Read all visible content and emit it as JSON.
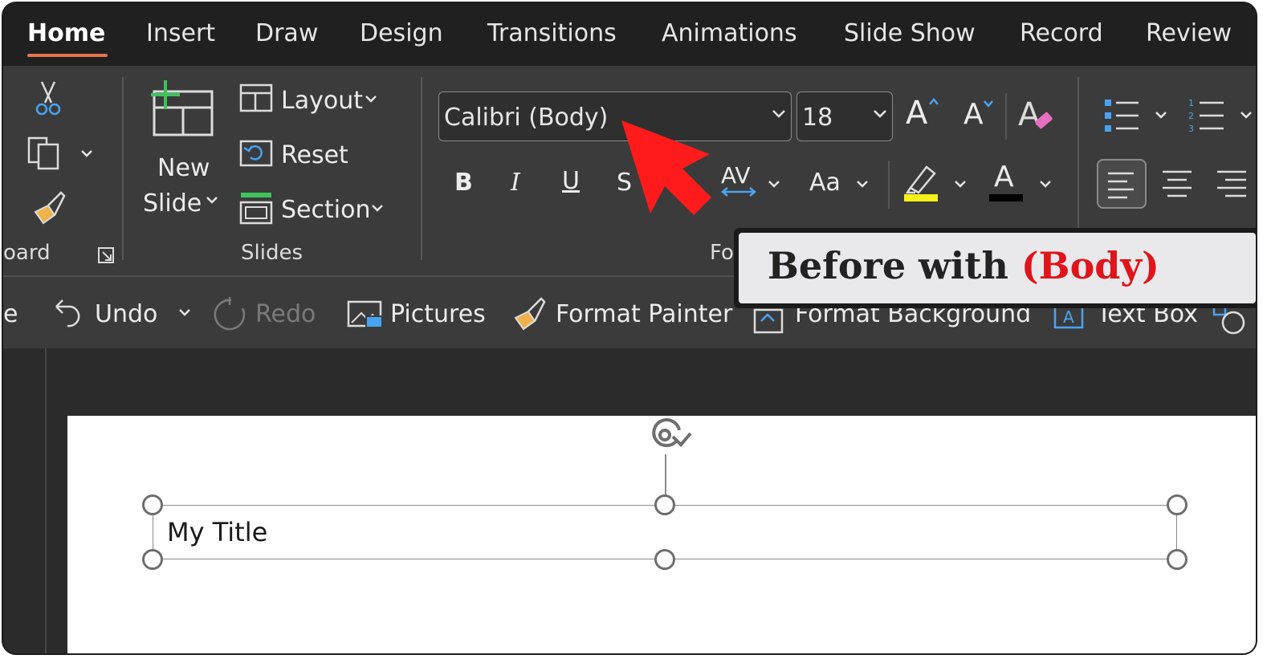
{
  "tabs": [
    {
      "label": "Home",
      "active": true
    },
    {
      "label": "Insert"
    },
    {
      "label": "Draw"
    },
    {
      "label": "Design"
    },
    {
      "label": "Transitions"
    },
    {
      "label": "Animations"
    },
    {
      "label": "Slide Show"
    },
    {
      "label": "Record"
    },
    {
      "label": "Review"
    }
  ],
  "ribbon": {
    "clipboard": {
      "group_label": "oard"
    },
    "slides": {
      "new_slide_line1": "New",
      "new_slide_line2": "Slide",
      "layout_label": "Layout",
      "reset_label": "Reset",
      "section_label": "Section",
      "group_label": "Slides"
    },
    "font": {
      "font_name": "Calibri (Body)",
      "font_size": "18",
      "bold": "B",
      "italic": "I",
      "underline": "U",
      "strike": "S",
      "spacing": "AV",
      "change_case": "Aa",
      "grow": "A",
      "shrink": "A",
      "font_color": "A",
      "group_label": "Fo",
      "highlight_color": "#f5f21a",
      "font_color_bar": "#000000"
    }
  },
  "qat": {
    "partial_label": "e",
    "undo_label": "Undo",
    "redo_label": "Redo",
    "pictures_label": "Pictures",
    "format_painter_label": "Format Painter",
    "format_background_label": "Format Background",
    "text_box_label": "Text Box"
  },
  "slide": {
    "title_text": "My Title"
  },
  "callout": {
    "prefix": "Before with ",
    "accent": "(Body)"
  },
  "colors": {
    "accent_underline": "#e8734c",
    "arrow": "#ff1b1b",
    "callout_accent": "#e0141b"
  }
}
